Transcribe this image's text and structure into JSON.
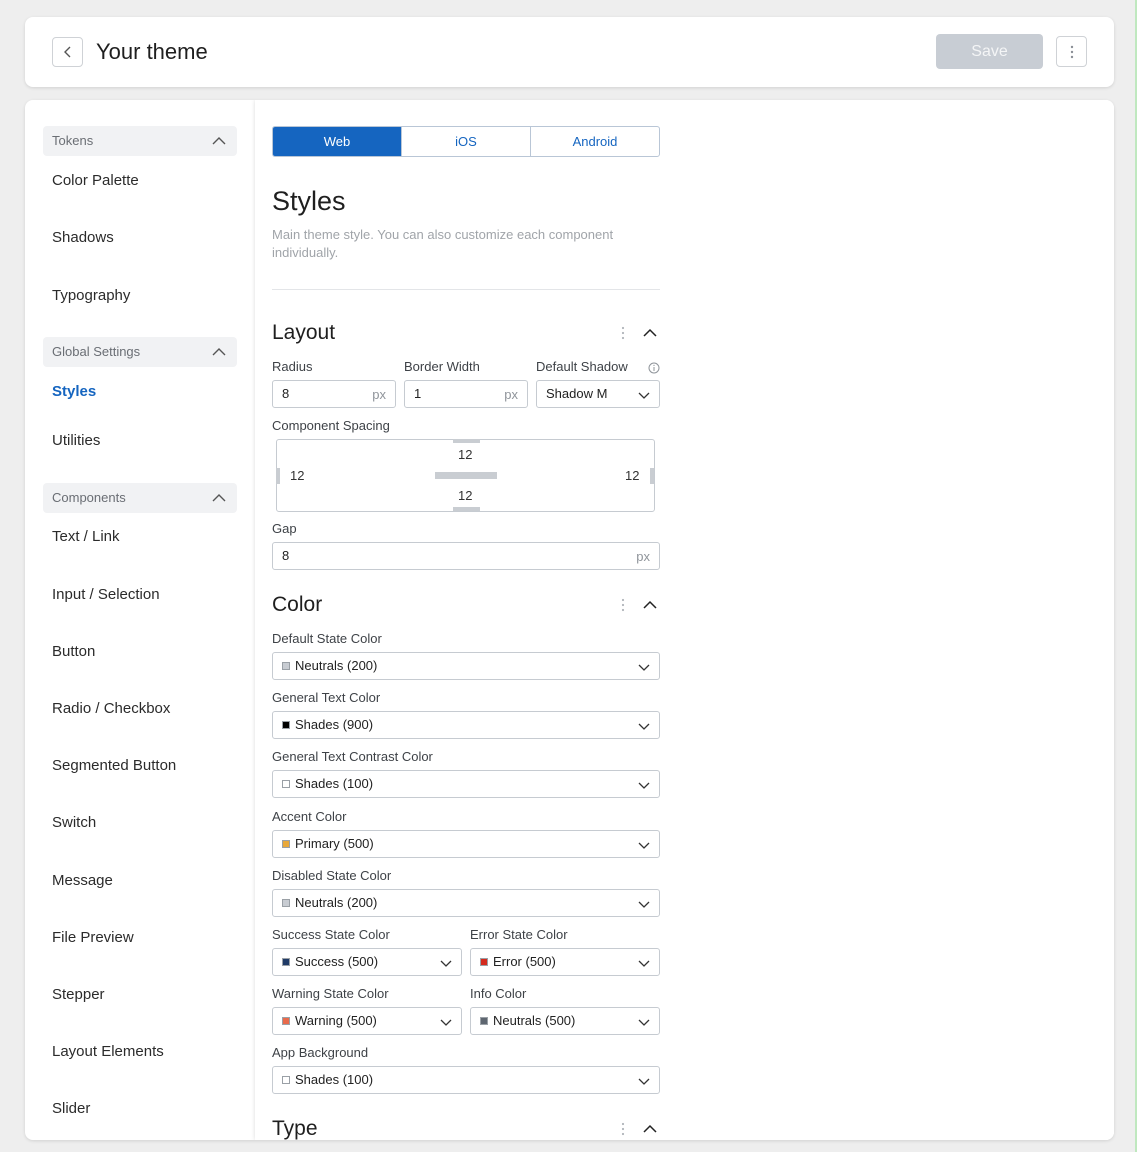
{
  "header": {
    "title": "Your theme",
    "save_label": "Save"
  },
  "sidebar": {
    "groups": [
      {
        "label": "Tokens",
        "items": [
          "Color Palette",
          "Shadows",
          "Typography"
        ]
      },
      {
        "label": "Global Settings",
        "items": [
          "Styles",
          "Utilities"
        ]
      },
      {
        "label": "Components",
        "items": [
          "Text / Link",
          "Input / Selection",
          "Button",
          "Radio / Checkbox",
          "Segmented Button",
          "Switch",
          "Message",
          "File Preview",
          "Stepper",
          "Layout Elements",
          "Slider"
        ]
      }
    ],
    "active_item": "Styles"
  },
  "panel": {
    "tabs": [
      "Web",
      "iOS",
      "Android"
    ],
    "active_tab": "Web",
    "title": "Styles",
    "description": "Main theme style. You can also customize each component individually.",
    "layout": {
      "title": "Layout",
      "radius_label": "Radius",
      "radius_value": "8",
      "radius_unit": "px",
      "border_width_label": "Border Width",
      "border_width_value": "1",
      "border_width_unit": "px",
      "default_shadow_label": "Default Shadow",
      "default_shadow_value": "Shadow M",
      "component_spacing_label": "Component Spacing",
      "spacing": {
        "top": "12",
        "left": "12",
        "right": "12",
        "bottom": "12"
      },
      "gap_label": "Gap",
      "gap_value": "8",
      "gap_unit": "px"
    },
    "color": {
      "title": "Color",
      "default_state_label": "Default State Color",
      "default_state_value": "Neutrals (200)",
      "default_state_swatch": "#c8ccd2",
      "general_text_label": "General Text Color",
      "general_text_value": "Shades (900)",
      "general_text_swatch": "#000000",
      "general_text_contrast_label": "General Text Contrast Color",
      "general_text_contrast_value": "Shades (100)",
      "general_text_contrast_swatch": "#ffffff",
      "accent_label": "Accent Color",
      "accent_value": "Primary (500)",
      "accent_swatch": "#e8a83a",
      "disabled_state_label": "Disabled State Color",
      "disabled_state_value": "Neutrals (200)",
      "disabled_state_swatch": "#c8ccd2",
      "success_label": "Success State Color",
      "success_value": "Success (500)",
      "success_swatch": "#1f3a66",
      "error_label": "Error State Color",
      "error_value": "Error (500)",
      "error_swatch": "#d42a1e",
      "warning_label": "Warning State Color",
      "warning_value": "Warning (500)",
      "warning_swatch": "#e96a4b",
      "info_label": "Info Color",
      "info_value": "Neutrals (500)",
      "info_swatch": "#5e6670",
      "app_background_label": "App Background",
      "app_background_value": "Shades (100)",
      "app_background_swatch": "#ffffff"
    },
    "type": {
      "title": "Type"
    }
  },
  "colors": {
    "accent": "#1565c0",
    "save_disabled": "#c8cdd4"
  }
}
